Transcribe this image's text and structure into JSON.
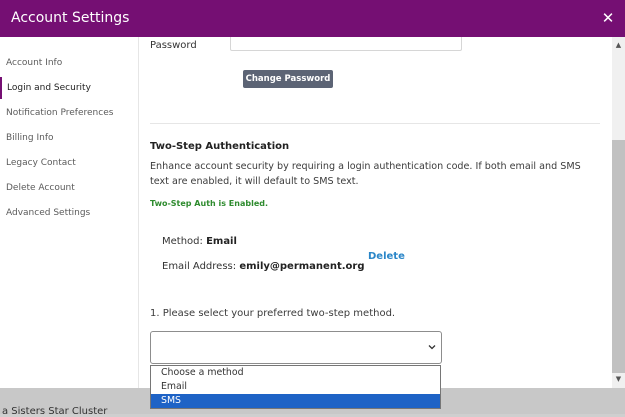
{
  "background": {
    "partial_text": "a Sisters Star Cluster"
  },
  "header": {
    "title": "Account Settings",
    "close_icon": "close-icon"
  },
  "sidebar": {
    "items": [
      {
        "label": "Account Info"
      },
      {
        "label": "Login and Security",
        "active": true
      },
      {
        "label": "Notification Preferences"
      },
      {
        "label": "Billing Info"
      },
      {
        "label": "Legacy Contact"
      },
      {
        "label": "Delete Account"
      },
      {
        "label": "Advanced Settings"
      }
    ]
  },
  "security": {
    "password_label": "Password",
    "password_value": "",
    "change_password_label": "Change Password",
    "two_step_title": "Two-Step Authentication",
    "two_step_description": "Enhance account security by requiring a login authentication code. If both email and SMS text are enabled, it will default to SMS text.",
    "status_text": "Two-Step Auth is Enabled.",
    "method_label": "Method:",
    "method_value": "Email",
    "email_label": "Email Address:",
    "email_value": "emily@permanent.org",
    "delete_label": "Delete",
    "select_prompt": "1. Please select your preferred two-step method.",
    "select_value": "",
    "options": [
      "Choose a method",
      "Email",
      "SMS"
    ],
    "highlighted_option": "SMS"
  },
  "colors": {
    "brand": "#750f73",
    "button": "#5c6475",
    "link": "#2a86c8",
    "success": "#2e8b2e",
    "highlight": "#1e63c6"
  }
}
